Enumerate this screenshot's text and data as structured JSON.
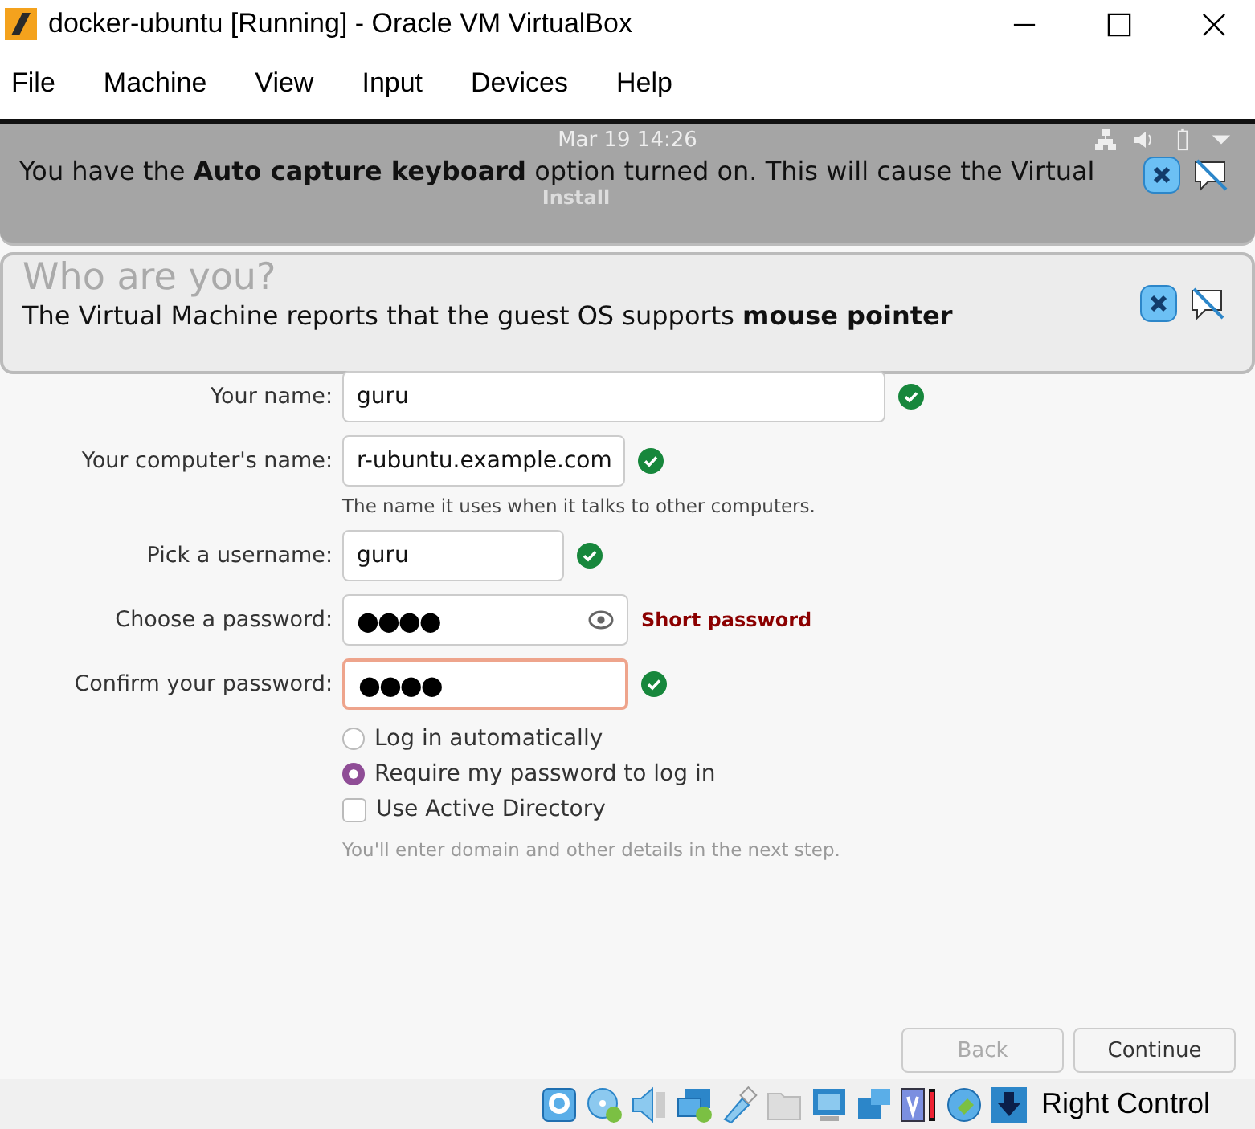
{
  "window": {
    "title": "docker-ubuntu [Running] - Oracle VM VirtualBox"
  },
  "menu": [
    "File",
    "Machine",
    "View",
    "Input",
    "Devices",
    "Help"
  ],
  "guest_top_bar": {
    "datetime": "Mar 19  14:26"
  },
  "notifications": [
    {
      "text": "You have the **Auto capture keyboard** option turned on. This will cause the Virtual",
      "subtitle": "Install"
    },
    {
      "text": "The Virtual Machine reports that the guest OS supports **mouse pointer**",
      "subtitle": "Who are you?"
    }
  ],
  "form": [
    {
      "kind": "text",
      "label": "Your name:",
      "value": "guru",
      "valid": true
    },
    {
      "kind": "text",
      "label": "Your computer's name:",
      "value": "r-ubuntu.example.com",
      "valid": true,
      "hint": "The name it uses when it talks to other computers."
    },
    {
      "kind": "text",
      "label": "Pick a username:",
      "value": "guru",
      "valid": true
    },
    {
      "kind": "password",
      "label": "Choose a password:",
      "value": "●●●●",
      "valid": false,
      "error": "Short password"
    },
    {
      "kind": "password",
      "label": "Confirm your password:",
      "value": "●●●●",
      "valid": true,
      "focused": true
    }
  ],
  "options": [
    {
      "kind": "radio",
      "label": "Log in automatically",
      "selected": false
    },
    {
      "kind": "radio",
      "label": "Require my password to log in",
      "selected": true
    },
    {
      "kind": "checkbox",
      "label": "Use Active Directory",
      "checked": false
    }
  ],
  "options_note": "You'll enter domain and other details in the next step.",
  "buttons": [
    {
      "label": "Back",
      "disabled": true
    },
    {
      "label": "Continue",
      "disabled": false
    }
  ],
  "status_bar": {
    "host_key": "Right Control"
  }
}
